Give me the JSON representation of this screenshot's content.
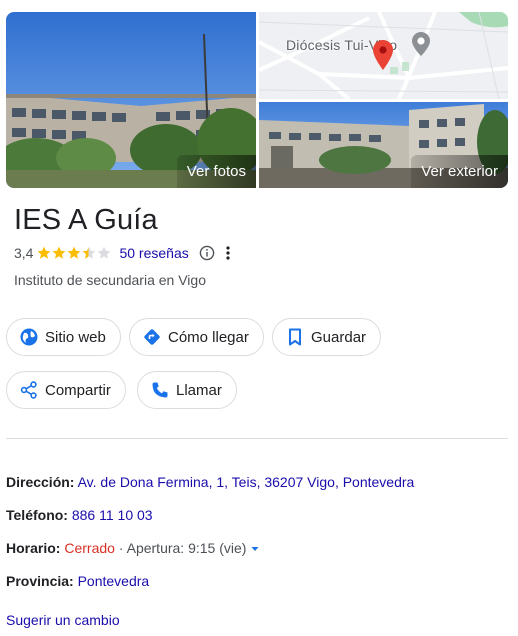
{
  "photos": {
    "main_label": "Ver fotos",
    "map_label": "Diócesis Tui-Vigo",
    "exterior_label": "Ver exterior"
  },
  "place": {
    "name": "IES A Guía",
    "rating": "3,4",
    "rating_value": 3.4,
    "reviews": "50 reseñas",
    "category": "Instituto de secundaria en Vigo"
  },
  "actions": {
    "website": "Sitio web",
    "directions": "Cómo llegar",
    "save": "Guardar",
    "share": "Compartir",
    "call": "Llamar"
  },
  "info": {
    "address_label": "Dirección:",
    "address_value": "Av. de Dona Fermina, 1, Teis, 36207 Vigo, Pontevedra",
    "phone_label": "Teléfono:",
    "phone_value": "886 11 10 03",
    "hours_label": "Horario:",
    "hours_status": "Cerrado",
    "hours_detail": " · Apertura: 9:15 (vie)",
    "province_label": "Provincia:",
    "province_value": "Pontevedra"
  },
  "suggest": "Sugerir un cambio",
  "colors": {
    "link": "#1a0dab",
    "closed": "#d93025",
    "star": "#fbbc04",
    "accent_blue": "#1a73e8",
    "map_pin": "#ea4335"
  }
}
